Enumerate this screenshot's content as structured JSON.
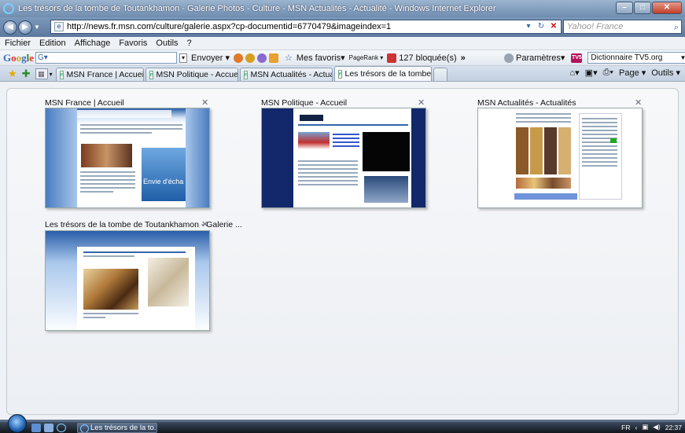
{
  "window": {
    "title": "Les trésors de la tombe de Toutankhamon - Galerie Photos - Culture - MSN Actualités - Actualité - Windows Internet Explorer",
    "minimize": "–",
    "maximize": "□",
    "close": "✕"
  },
  "address": {
    "url": "http://news.fr.msn.com/culture/galerie.aspx?cp-documentid=6770479&imageindex=1",
    "search_placeholder": "Yahoo! France"
  },
  "menu": [
    "Fichier",
    "Edition",
    "Affichage",
    "Favoris",
    "Outils",
    "?"
  ],
  "google_toolbar": {
    "logo": "Google",
    "search_value": "G▾",
    "envoyer": "Envoyer ▾",
    "mes_favoris": "Mes favoris▾",
    "pagerank": "PageRank ▾",
    "blocked": "127 bloquée(s)",
    "more": "»",
    "parametres": "Paramètres▾",
    "dictionnaire": "Dictionnaire TV5.org"
  },
  "tabs": [
    {
      "label": "MSN France | Accueil"
    },
    {
      "label": "MSN Politique - Accueil"
    },
    {
      "label": "MSN Actualités - Actualités"
    },
    {
      "label": "Les trésors de la tombe ...",
      "active": true
    }
  ],
  "command_bar": {
    "page": "Page ▾",
    "outils": "Outils ▾"
  },
  "quick_tabs": [
    {
      "title": "MSN France | Accueil",
      "ad_text": "Envie d'écha"
    },
    {
      "title": "MSN Politique - Accueil"
    },
    {
      "title": "MSN Actualités - Actualités"
    },
    {
      "title": "Les trésors de la tombe de Toutankhamon - Galerie ..."
    }
  ],
  "taskbar": {
    "task_label": "Les trésors de la to...",
    "lang": "FR",
    "clock": "22:37"
  },
  "colors": {
    "accent": "#2a5ea8",
    "titlebar": "#6f8db0",
    "tab_active": "#f6f8fb"
  }
}
